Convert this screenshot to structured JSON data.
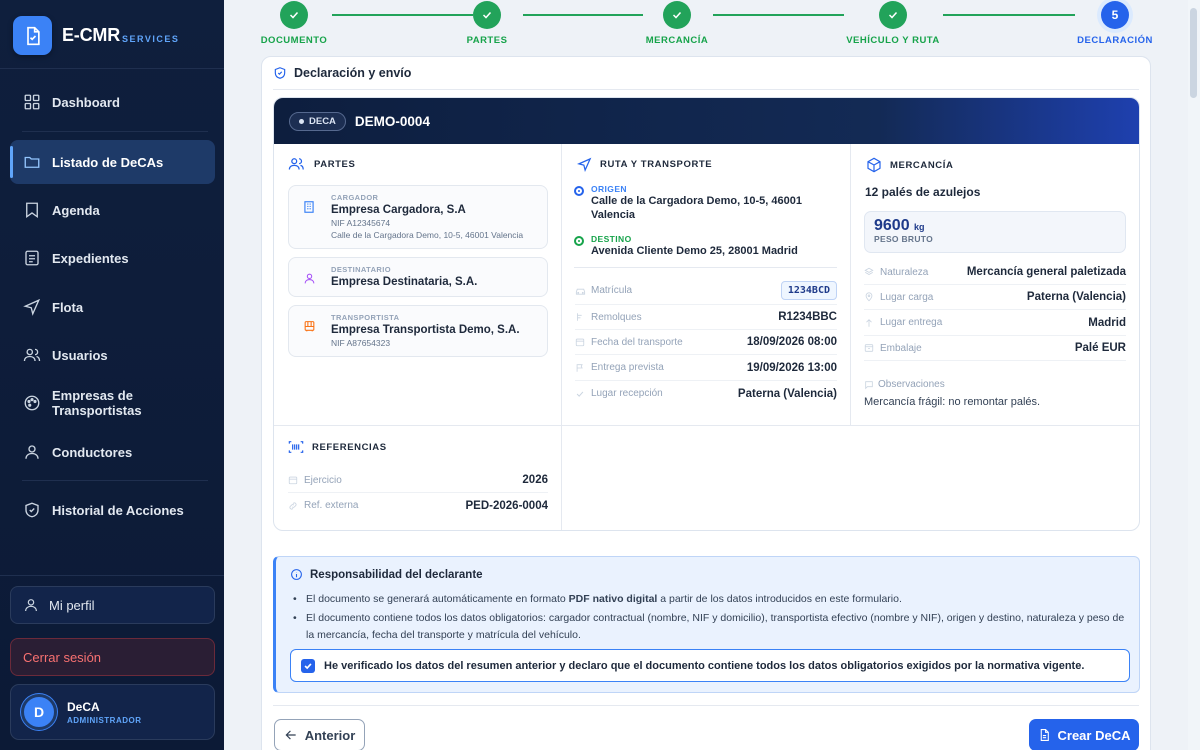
{
  "app": {
    "name": "E-CMR",
    "sub": "SERVICES"
  },
  "sidebar": {
    "items": [
      {
        "label": "Dashboard",
        "icon": "grid-icon"
      },
      {
        "label": "Listado de DeCAs",
        "icon": "folder-icon",
        "active": true
      },
      {
        "label": "Agenda",
        "icon": "bookmark-icon"
      },
      {
        "label": "Expedientes",
        "icon": "file-list-icon"
      },
      {
        "label": "Flota",
        "icon": "navigation-icon"
      },
      {
        "label": "Usuarios",
        "icon": "users-icon"
      },
      {
        "label": "Empresas de Transportistas",
        "icon": "palette-icon"
      },
      {
        "label": "Conductores",
        "icon": "user-icon"
      },
      {
        "label": "Historial de Acciones",
        "icon": "shield-icon"
      }
    ],
    "profile_label": "Mi perfil",
    "logout_label": "Cerrar sesión",
    "user": {
      "initial": "D",
      "name": "DeCA",
      "role": "ADMINISTRADOR"
    }
  },
  "stepper": {
    "steps": [
      {
        "label": "DOCUMENTO",
        "state": "done"
      },
      {
        "label": "PARTES",
        "state": "done"
      },
      {
        "label": "MERCANCÍA",
        "state": "done"
      },
      {
        "label": "VEHÍCULO Y RUTA",
        "state": "done"
      },
      {
        "label": "DECLARACIÓN",
        "state": "current",
        "number": "5"
      }
    ]
  },
  "section_title": "Declaración y envío",
  "summary": {
    "badge": "DECA",
    "doc_id": "DEMO-0004",
    "parties": {
      "title": "PARTES",
      "cargador": {
        "label": "CARGADOR",
        "name": "Empresa Cargadora, S.A",
        "nif": "NIF A12345674",
        "address": "Calle de la Cargadora Demo, 10-5, 46001 Valencia"
      },
      "destinatario": {
        "label": "DESTINATARIO",
        "name": "Empresa Destinataria, S.A."
      },
      "transportista": {
        "label": "TRANSPORTISTA",
        "name": "Empresa Transportista Demo, S.A.",
        "nif": "NIF A87654323"
      }
    },
    "references": {
      "title": "REFERENCIAS",
      "rows": [
        {
          "label": "Ejercicio",
          "value": "2026"
        },
        {
          "label": "Ref. externa",
          "value": "PED-2026-0004"
        }
      ]
    },
    "route": {
      "title": "RUTA Y TRANSPORTE",
      "origin_label": "ORIGEN",
      "origin": "Calle de la Cargadora Demo, 10-5, 46001 Valencia",
      "dest_label": "DESTINO",
      "dest": "Avenida Cliente Demo 25, 28001 Madrid",
      "rows": [
        {
          "label": "Matrícula",
          "value": "1234BCD"
        },
        {
          "label": "Remolques",
          "value": "R1234BBC"
        },
        {
          "label": "Fecha del transporte",
          "value": "18/09/2026 08:00"
        },
        {
          "label": "Entrega prevista",
          "value": "19/09/2026 13:00"
        },
        {
          "label": "Lugar recepción",
          "value": "Paterna (Valencia)"
        }
      ]
    },
    "goods": {
      "title": "MERCANCÍA",
      "description": "12 palés de azulejos",
      "weight": "9600",
      "weight_unit": "kg",
      "weight_label": "PESO BRUTO",
      "rows": [
        {
          "label": "Naturaleza",
          "value": "Mercancía general paletizada"
        },
        {
          "label": "Lugar carga",
          "value": "Paterna (Valencia)"
        },
        {
          "label": "Lugar entrega",
          "value": "Madrid"
        },
        {
          "label": "Embalaje",
          "value": "Palé EUR"
        }
      ],
      "obs_label": "Observaciones",
      "obs": "Mercancía frágil: no remontar palés."
    }
  },
  "responsibility": {
    "title": "Responsabilidad del declarante",
    "line1_a": "El documento se generará automáticamente en formato ",
    "line1_b": "PDF nativo digital",
    "line1_c": " a partir de los datos introducidos en este formulario.",
    "line2": "El documento contiene todos los datos obligatorios: cargador contractual (nombre, NIF y domicilio), transportista efectivo (nombre y NIF), origen y destino, naturaleza y peso de la mercancía, fecha del transporte y matrícula del vehículo.",
    "check_label": "He verificado los datos del resumen anterior y declaro que el documento contiene todos los datos obligatorios exigidos por la normativa vigente.",
    "checked": true
  },
  "footer": {
    "prev_label": "Anterior",
    "create_label": "Crear DeCA"
  },
  "colors": {
    "accent": "#2563eb",
    "success": "#22a35a",
    "sidebar": "#0f1f3d"
  }
}
